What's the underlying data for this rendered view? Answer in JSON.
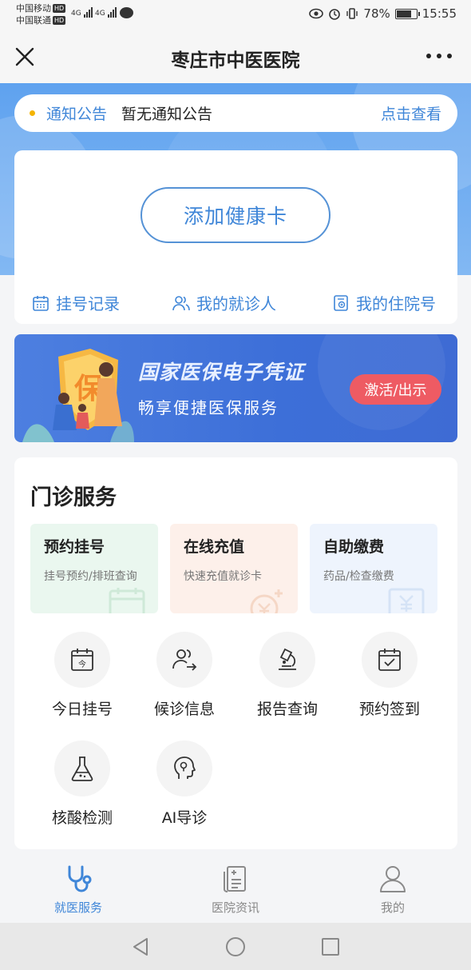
{
  "status_bar": {
    "carrier1": "中国移动",
    "carrier2": "中国联通",
    "hd": "HD",
    "net1": "4G",
    "net2": "4G",
    "battery_text": "78%",
    "battery_level": 0.78,
    "time": "15:55"
  },
  "titlebar": {
    "title": "枣庄市中医医院"
  },
  "notice": {
    "tag": "通知公告",
    "message": "暂无通知公告",
    "action": "点击查看"
  },
  "health_card": {
    "add_label": "添加健康卡",
    "links": [
      {
        "label": "挂号记录",
        "icon": "calendar-icon"
      },
      {
        "label": "我的就诊人",
        "icon": "people-icon"
      },
      {
        "label": "我的住院号",
        "icon": "document-icon"
      }
    ]
  },
  "banner": {
    "title": "国家医保电子凭证",
    "subtitle": "畅享便捷医保服务",
    "button": "激活/出示",
    "shield_char": "保"
  },
  "outpatient": {
    "title": "门诊服务",
    "cards": [
      {
        "name": "预约挂号",
        "desc": "挂号预约/排班查询",
        "color": "#eaf7ef",
        "icon": "calendar-outline-icon"
      },
      {
        "name": "在线充值",
        "desc": "快速充值就诊卡",
        "color": "#fdf0ea",
        "icon": "yen-plus-icon"
      },
      {
        "name": "自助缴费",
        "desc": "药品/检查缴费",
        "color": "#eef4fd",
        "icon": "yen-box-icon"
      }
    ],
    "grid": [
      {
        "label": "今日挂号",
        "icon": "today-calendar-icon",
        "glyph": "今"
      },
      {
        "label": "候诊信息",
        "icon": "waiting-people-icon"
      },
      {
        "label": "报告查询",
        "icon": "microscope-icon"
      },
      {
        "label": "预约签到",
        "icon": "calendar-check-icon"
      },
      {
        "label": "核酸检测",
        "icon": "flask-icon"
      },
      {
        "label": "AI导诊",
        "icon": "ai-head-icon"
      }
    ]
  },
  "bottom_nav": [
    {
      "label": "就医服务",
      "icon": "stethoscope-icon",
      "active": true
    },
    {
      "label": "医院资讯",
      "icon": "news-icon",
      "active": false
    },
    {
      "label": "我的",
      "icon": "user-icon",
      "active": false
    }
  ],
  "colors": {
    "accent": "#3f86d8",
    "banner_button": "#ee5b63",
    "notice_dot": "#f4b400"
  }
}
